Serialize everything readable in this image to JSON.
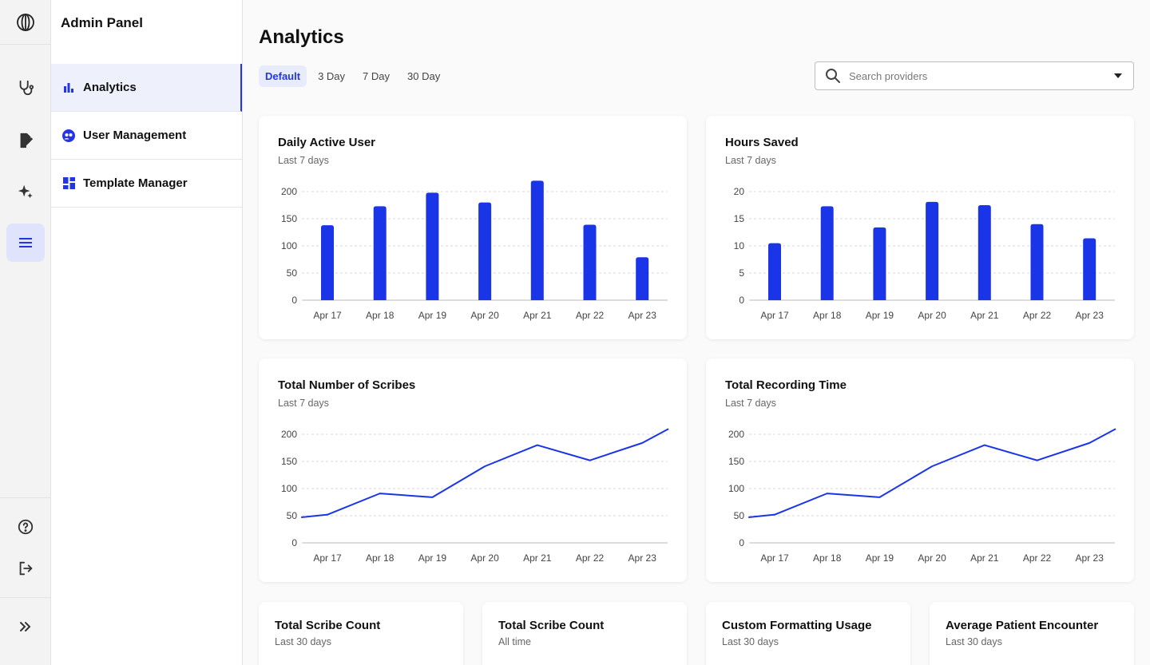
{
  "app": {
    "panel_title": "Admin Panel"
  },
  "rail": {
    "icons": [
      "logo-icon",
      "stethoscope-icon",
      "document-edit-icon",
      "sparkle-icon",
      "menu-icon",
      "help-icon",
      "logout-icon",
      "expand-icon"
    ],
    "active": "menu-icon"
  },
  "nav": {
    "items": [
      {
        "label": "Analytics",
        "icon": "bar-chart-icon",
        "active": true
      },
      {
        "label": "User Management",
        "icon": "users-icon",
        "active": false
      },
      {
        "label": "Template Manager",
        "icon": "grid-icon",
        "active": false
      }
    ]
  },
  "main": {
    "title": "Analytics",
    "filters": [
      "Default",
      "3 Day",
      "7 Day",
      "30 Day"
    ],
    "active_filter": "Default",
    "search": {
      "placeholder": "Search providers",
      "value": ""
    }
  },
  "colors": {
    "accent": "#1a35e8",
    "grid": "#d9d9d9"
  },
  "cards": [
    {
      "title": "Daily Active User",
      "subtitle": "Last 7 days"
    },
    {
      "title": "Hours Saved",
      "subtitle": "Last 7 days"
    },
    {
      "title": "Total Number of Scribes",
      "subtitle": "Last 7 days"
    },
    {
      "title": "Total Recording Time",
      "subtitle": "Last 7 days"
    }
  ],
  "stats": [
    {
      "title": "Total Scribe Count",
      "subtitle": "Last 30 days",
      "value": ""
    },
    {
      "title": "Total Scribe Count",
      "subtitle": "All time",
      "value": ""
    },
    {
      "title": "Custom Formatting Usage",
      "subtitle": "Last 30 days",
      "value": ""
    },
    {
      "title": "Average Patient Encounter",
      "subtitle": "Last 30 days",
      "value": ""
    }
  ],
  "chart_data": [
    {
      "type": "bar",
      "title": "Daily Active User",
      "subtitle": "Last 7 days",
      "categories": [
        "Apr 17",
        "Apr 18",
        "Apr 19",
        "Apr 20",
        "Apr 21",
        "Apr 22",
        "Apr 23"
      ],
      "values": [
        138,
        173,
        198,
        180,
        220,
        139,
        79
      ],
      "ylim": [
        0,
        200
      ],
      "yticks": [
        0,
        50,
        100,
        150,
        200
      ],
      "grid": true
    },
    {
      "type": "bar",
      "title": "Hours Saved",
      "subtitle": "Last 7 days",
      "categories": [
        "Apr 17",
        "Apr 18",
        "Apr 19",
        "Apr 20",
        "Apr 21",
        "Apr 22",
        "Apr 23"
      ],
      "values": [
        10.5,
        17.3,
        13.4,
        18.1,
        17.5,
        14.0,
        11.4
      ],
      "ylim": [
        0,
        20
      ],
      "yticks": [
        0,
        5,
        10,
        15,
        20
      ],
      "grid": true
    },
    {
      "type": "line",
      "title": "Total Number of Scribes",
      "subtitle": "Last 7 days",
      "x": [
        16.5,
        17.0,
        18.0,
        19.0,
        20.0,
        21.0,
        22.0,
        23.0,
        23.5
      ],
      "values": [
        47,
        52,
        91,
        84,
        141,
        180,
        152,
        184,
        210
      ],
      "categories": [
        "Apr 17",
        "Apr 18",
        "Apr 19",
        "Apr 20",
        "Apr 21",
        "Apr 22",
        "Apr 23"
      ],
      "ylim": [
        0,
        200
      ],
      "yticks": [
        0,
        50,
        100,
        150,
        200
      ],
      "grid": true
    },
    {
      "type": "line",
      "title": "Total Recording Time",
      "subtitle": "Last 7 days",
      "x": [
        16.5,
        17.0,
        18.0,
        19.0,
        20.0,
        21.0,
        22.0,
        23.0,
        23.5
      ],
      "values": [
        47,
        52,
        91,
        84,
        141,
        180,
        152,
        184,
        210
      ],
      "categories": [
        "Apr 17",
        "Apr 18",
        "Apr 19",
        "Apr 20",
        "Apr 21",
        "Apr 22",
        "Apr 23"
      ],
      "ylim": [
        0,
        200
      ],
      "yticks": [
        0,
        50,
        100,
        150,
        200
      ],
      "grid": true
    }
  ]
}
